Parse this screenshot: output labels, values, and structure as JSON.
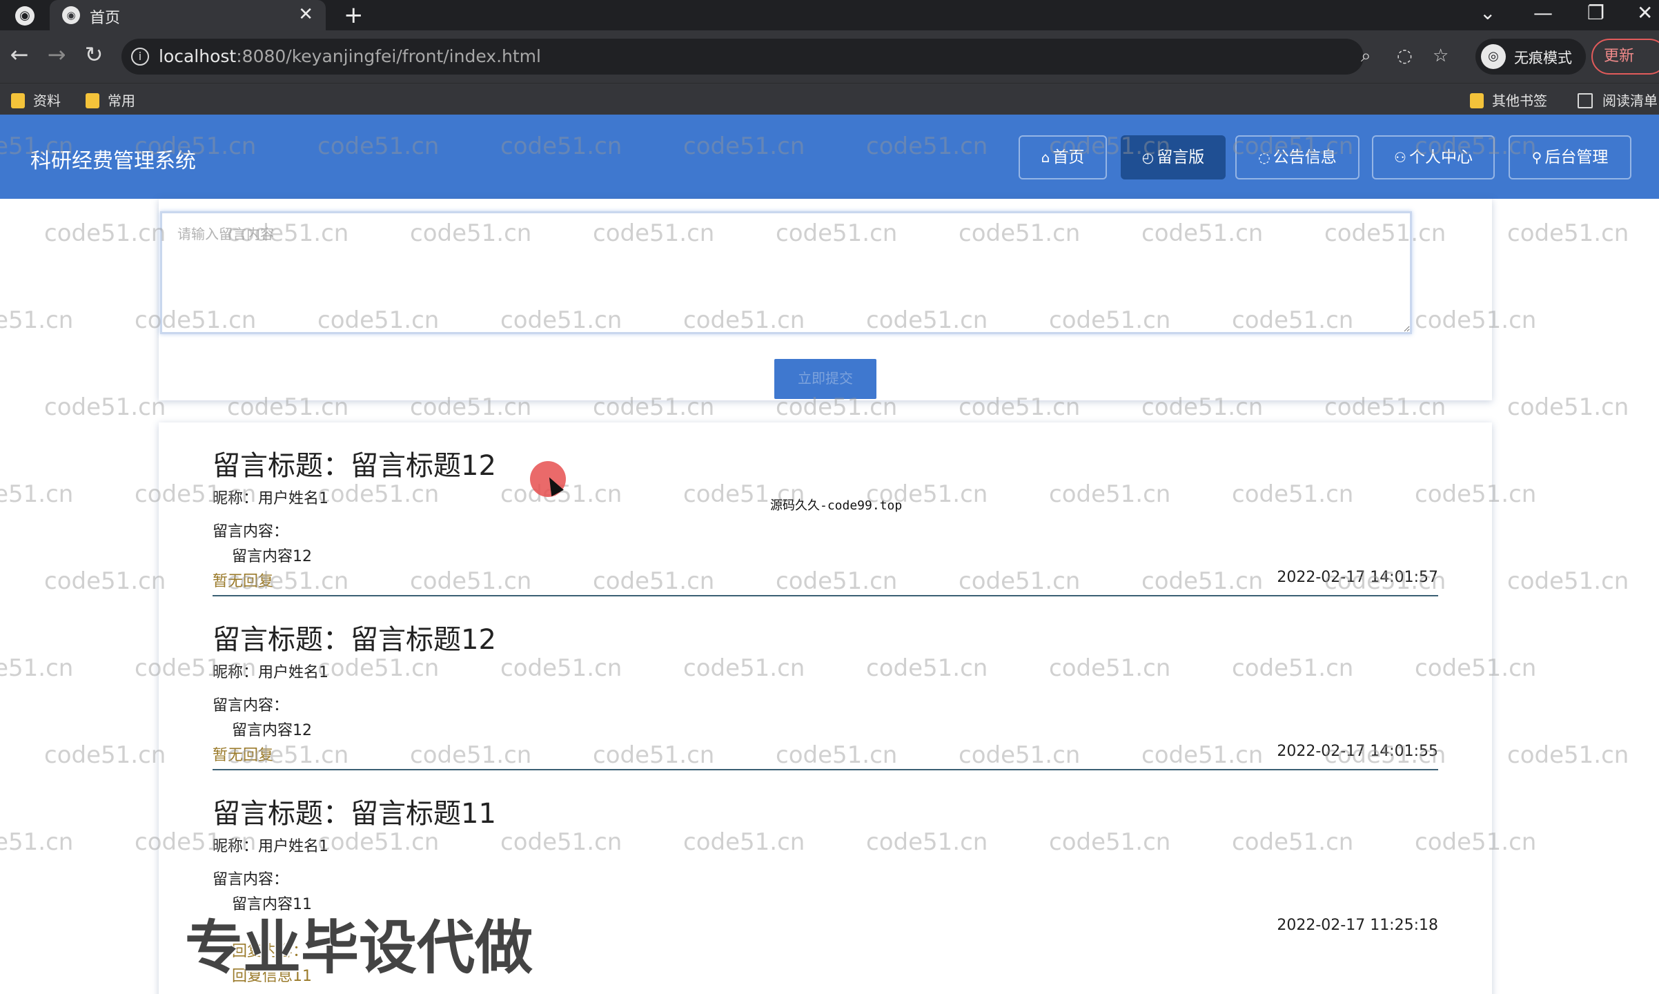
{
  "browser": {
    "tab_title": "首页",
    "url_host": "localhost",
    "url_rest": ":8080/keyanjingfei/front/index.html",
    "incognito_label": "无痕模式",
    "update_label": "更新",
    "bookmarks": [
      "资料",
      "常用"
    ],
    "bookmarks_right": [
      "其他书签",
      "阅读清单"
    ]
  },
  "header": {
    "site_title": "科研经费管理系统",
    "nav": [
      {
        "label": "首页",
        "icon": "home-icon"
      },
      {
        "label": "留言版",
        "icon": "message-icon"
      },
      {
        "label": "公告信息",
        "icon": "notice-icon"
      },
      {
        "label": "个人中心",
        "icon": "user-icon"
      },
      {
        "label": "后台管理",
        "icon": "link-icon"
      }
    ]
  },
  "form": {
    "placeholder": "请输入留言内容",
    "submit_label": "立即提交"
  },
  "messages": [
    {
      "title": "留言标题：留言标题12",
      "nickname": "昵称：用户姓名1",
      "content_label": "留言内容：",
      "content": "留言内容12",
      "reply": "暂无回复",
      "time": "2022-02-17 14:01:57"
    },
    {
      "title": "留言标题：留言标题12",
      "nickname": "昵称：用户姓名1",
      "content_label": "留言内容：",
      "content": "留言内容12",
      "reply": "暂无回复",
      "time": "2022-02-17 14:01:55"
    },
    {
      "title": "留言标题：留言标题11",
      "nickname": "昵称：用户姓名1",
      "content_label": "留言内容：",
      "content": "留言内容11",
      "reply_label": "回复内容：",
      "reply_text": "回复信息11",
      "time": "2022-02-17 11:25:18"
    }
  ],
  "overlay": {
    "watermark": "code51.cn",
    "source_note": "源码久久-code99.top",
    "promo": "专业毕设代做"
  },
  "colors": {
    "header_bg": "#3f78cf",
    "nav_active_bg": "#1f4f93",
    "reply_text": "#9a7a2a",
    "divider": "#3a5f73"
  }
}
